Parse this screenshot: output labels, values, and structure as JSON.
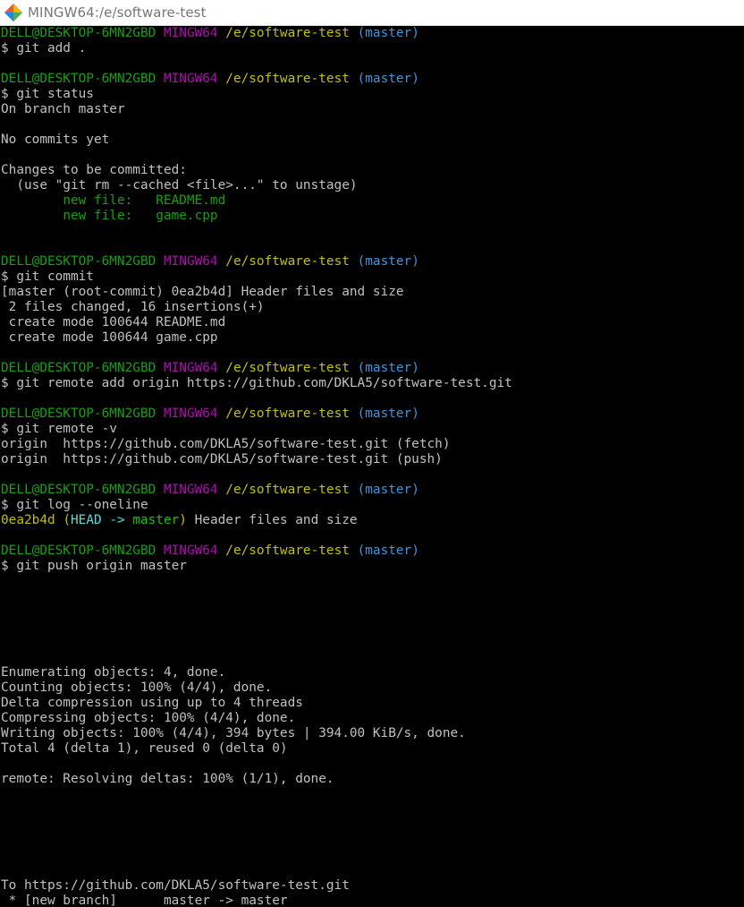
{
  "window": {
    "title": "MINGW64:/e/software-test",
    "icon": "git-bash-icon"
  },
  "colors": {
    "background": "#000000",
    "user_host": "#13a10e",
    "msystem": "#b00bb0",
    "path": "#c1c100",
    "branch": "#3a96dd",
    "text": "#c0c0c0",
    "head": "#48e0e0",
    "branch_ref": "#16c60c"
  },
  "lines": [
    [
      {
        "t": "DELL@DESKTOP-6MN2GBD",
        "c": "green"
      },
      {
        "t": " "
      },
      {
        "t": "MINGW64",
        "c": "purple"
      },
      {
        "t": " "
      },
      {
        "t": "/e/software-test",
        "c": "yellow"
      },
      {
        "t": " "
      },
      {
        "t": "(master)",
        "c": "cyan"
      }
    ],
    [
      {
        "t": "$ git add ."
      }
    ],
    [],
    [
      {
        "t": "DELL@DESKTOP-6MN2GBD",
        "c": "green"
      },
      {
        "t": " "
      },
      {
        "t": "MINGW64",
        "c": "purple"
      },
      {
        "t": " "
      },
      {
        "t": "/e/software-test",
        "c": "yellow"
      },
      {
        "t": " "
      },
      {
        "t": "(master)",
        "c": "cyan"
      }
    ],
    [
      {
        "t": "$ git status"
      }
    ],
    [
      {
        "t": "On branch master"
      }
    ],
    [],
    [
      {
        "t": "No commits yet"
      }
    ],
    [],
    [
      {
        "t": "Changes to be committed:"
      }
    ],
    [
      {
        "t": "  (use \"git rm --cached <file>...\" to unstage)"
      }
    ],
    [
      {
        "t": "        "
      },
      {
        "t": "new file:   README.md",
        "c": "green"
      }
    ],
    [
      {
        "t": "        "
      },
      {
        "t": "new file:   game.cpp",
        "c": "green"
      }
    ],
    [],
    [],
    [
      {
        "t": "DELL@DESKTOP-6MN2GBD",
        "c": "green"
      },
      {
        "t": " "
      },
      {
        "t": "MINGW64",
        "c": "purple"
      },
      {
        "t": " "
      },
      {
        "t": "/e/software-test",
        "c": "yellow"
      },
      {
        "t": " "
      },
      {
        "t": "(master)",
        "c": "cyan"
      }
    ],
    [
      {
        "t": "$ git commit"
      }
    ],
    [
      {
        "t": "[master (root-commit) 0ea2b4d] Header files and size"
      }
    ],
    [
      {
        "t": " 2 files changed, 16 insertions(+)"
      }
    ],
    [
      {
        "t": " create mode 100644 README.md"
      }
    ],
    [
      {
        "t": " create mode 100644 game.cpp"
      }
    ],
    [],
    [
      {
        "t": "DELL@DESKTOP-6MN2GBD",
        "c": "green"
      },
      {
        "t": " "
      },
      {
        "t": "MINGW64",
        "c": "purple"
      },
      {
        "t": " "
      },
      {
        "t": "/e/software-test",
        "c": "yellow"
      },
      {
        "t": " "
      },
      {
        "t": "(master)",
        "c": "cyan"
      }
    ],
    [
      {
        "t": "$ git remote add origin https://github.com/DKLA5/software-test.git"
      }
    ],
    [],
    [
      {
        "t": "DELL@DESKTOP-6MN2GBD",
        "c": "green"
      },
      {
        "t": " "
      },
      {
        "t": "MINGW64",
        "c": "purple"
      },
      {
        "t": " "
      },
      {
        "t": "/e/software-test",
        "c": "yellow"
      },
      {
        "t": " "
      },
      {
        "t": "(master)",
        "c": "cyan"
      }
    ],
    [
      {
        "t": "$ git remote -v"
      }
    ],
    [
      {
        "t": "origin  https://github.com/DKLA5/software-test.git (fetch)"
      }
    ],
    [
      {
        "t": "origin  https://github.com/DKLA5/software-test.git (push)"
      }
    ],
    [],
    [
      {
        "t": "DELL@DESKTOP-6MN2GBD",
        "c": "green"
      },
      {
        "t": " "
      },
      {
        "t": "MINGW64",
        "c": "purple"
      },
      {
        "t": " "
      },
      {
        "t": "/e/software-test",
        "c": "yellow"
      },
      {
        "t": " "
      },
      {
        "t": "(master)",
        "c": "cyan"
      }
    ],
    [
      {
        "t": "$ git log --oneline"
      }
    ],
    [
      {
        "t": "0ea2b4d",
        "c": "yellow"
      },
      {
        "t": " "
      },
      {
        "t": "(",
        "c": "yellow"
      },
      {
        "t": "HEAD -> ",
        "c": "cyanb"
      },
      {
        "t": "master",
        "c": "greenb"
      },
      {
        "t": ")",
        "c": "yellow"
      },
      {
        "t": " Header files and size"
      }
    ],
    [],
    [
      {
        "t": "DELL@DESKTOP-6MN2GBD",
        "c": "green"
      },
      {
        "t": " "
      },
      {
        "t": "MINGW64",
        "c": "purple"
      },
      {
        "t": " "
      },
      {
        "t": "/e/software-test",
        "c": "yellow"
      },
      {
        "t": " "
      },
      {
        "t": "(master)",
        "c": "cyan"
      }
    ],
    [
      {
        "t": "$ git push origin master"
      }
    ],
    [],
    [],
    [],
    [],
    [],
    [],
    [
      {
        "t": "Enumerating objects: 4, done."
      }
    ],
    [
      {
        "t": "Counting objects: 100% (4/4), done."
      }
    ],
    [
      {
        "t": "Delta compression using up to 4 threads"
      }
    ],
    [
      {
        "t": "Compressing objects: 100% (4/4), done."
      }
    ],
    [
      {
        "t": "Writing objects: 100% (4/4), 394 bytes | 394.00 KiB/s, done."
      }
    ],
    [
      {
        "t": "Total 4 (delta 1), reused 0 (delta 0)"
      }
    ],
    [],
    [
      {
        "t": "remote: Resolving deltas: 100% (1/1), done."
      }
    ],
    [],
    [],
    [],
    [],
    [],
    [],
    [
      {
        "t": "To https://github.com/DKLA5/software-test.git"
      }
    ],
    [
      {
        "t": " * [new branch]      master -> master"
      }
    ]
  ]
}
